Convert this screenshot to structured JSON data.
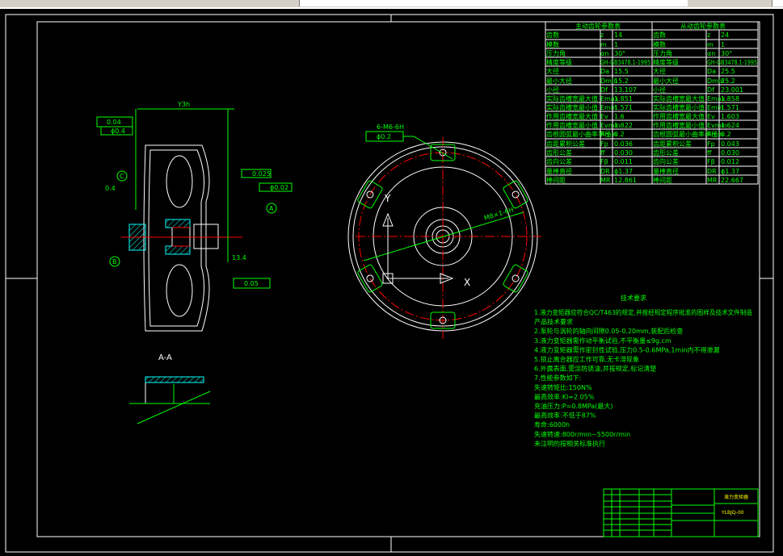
{
  "app": {
    "toolbar_visible": true
  },
  "colors": {
    "background": "#000000",
    "annotation": "#00ff00",
    "geometry": "#ffffff",
    "centerline": "#ff0000",
    "section_hatch": "#00ffff",
    "title_text": "#ffff00"
  },
  "gear_table": {
    "headers": [
      "主动齿轮参数表",
      "从动齿轮参数表"
    ],
    "left": [
      [
        "齿数",
        "z",
        "14"
      ],
      [
        "模数",
        "m",
        "1"
      ],
      [
        "压力角",
        "αn",
        "30°"
      ],
      [
        "精度等级",
        "GH-GB3478.1-1995",
        ""
      ],
      [
        "大径",
        "Da",
        "15.5"
      ],
      [
        "最小大径",
        "Dmin",
        "15.2"
      ],
      [
        "小径",
        "Df",
        "13.107"
      ],
      [
        "实际齿槽宽最大值",
        "Emax",
        "1.851"
      ],
      [
        "实际齿槽宽最小值",
        "Emin",
        "1.571"
      ],
      [
        "作用齿槽宽最大值",
        "Ev",
        "1.6"
      ],
      [
        "作用齿槽宽最小值",
        "Evmin",
        "1.822"
      ],
      [
        "齿根圆弧最小曲率半径",
        "Rmin",
        "0.2"
      ],
      [
        "齿距累积公差",
        "Fp",
        "0.036"
      ],
      [
        "齿形公差",
        "ff",
        "0.030"
      ],
      [
        "齿向公差",
        "Fβ",
        "0.011"
      ],
      [
        "量棒直径",
        "DR",
        "ϕ1.37"
      ],
      [
        "棒间距",
        "MR",
        "12.861"
      ]
    ],
    "right": [
      [
        "齿数",
        "z",
        "24"
      ],
      [
        "模数",
        "m",
        "1"
      ],
      [
        "压力角",
        "αn",
        "30°"
      ],
      [
        "精度等级",
        "GH-GB3478.1-1995",
        ""
      ],
      [
        "大径",
        "Da",
        "25.5"
      ],
      [
        "最小大径",
        "Dmin",
        "25.2"
      ],
      [
        "小径",
        "Df",
        "23.001"
      ],
      [
        "实际齿槽宽最大值",
        "Emax",
        "1.858"
      ],
      [
        "实际齿槽宽最小值",
        "Emin",
        "1.571"
      ],
      [
        "作用齿槽宽最大值",
        "Ev",
        "1.603"
      ],
      [
        "作用齿槽宽最小值",
        "Evmin",
        "1.624"
      ],
      [
        "齿根圆弧最小曲率半径",
        "Rmin",
        "0.2"
      ],
      [
        "齿距累积公差",
        "Fp",
        "0.043"
      ],
      [
        "齿形公差",
        "ff",
        "0.030"
      ],
      [
        "齿向公差",
        "Fβ",
        "0.012"
      ],
      [
        "量棒直径",
        "DR",
        "ϕ1.37"
      ],
      [
        "棒间距",
        "MR",
        "22.667"
      ]
    ]
  },
  "notes": {
    "title": "技术要求",
    "lines": [
      "1.液力变矩器应符合QC/T463的规定,并按经规定程序批准的图样及技术文件制造",
      "  产品技术要求",
      "2.泵轮与涡轮的轴向间隙0.05-0.20mm,装配后检查",
      "3.液力变矩器需作动平衡试验,不平衡量≤9g.cm",
      "4.液力变矩器需作密封性试验,压力0.5-0.6MPa,1min内不得渗漏",
      "5.锁止离合器应工作可靠,无卡滞现象",
      "6.外露表面,需涂防锈油,并按规定,标记清楚",
      "7.性能参数如下:",
      "  失速转矩比:150N%",
      "  最高效率:KI=2.05%",
      "  充油压力:P=0.8MPa(最大)",
      "  最高效率:不低于87%",
      "  寿命:6000h",
      "  失速转速:800r/min~5500r/min",
      "  未注明的按相关标准执行"
    ]
  },
  "drawing": {
    "section_label": "A-A",
    "overall_dim": "Y3h",
    "datum_A": "A",
    "datum_B": "B",
    "datum_C": "C",
    "axis_x": "X",
    "axis_y": "Y",
    "bolt_pattern": "6-M6-6H",
    "thread_callout": "M8×1-6H",
    "tol_flat": "0.025",
    "tol_conc": "ϕ0.02",
    "tol_runout": "0.05",
    "tol_pos": "ϕ0.2",
    "tol_top": "0.04",
    "tol_top2": "ϕ0.4",
    "surface": "0.4",
    "dim_len": "13.4"
  },
  "title_block": {
    "drawing_name": "液力变矩器",
    "drawing_number": "YLBJQ-00"
  }
}
